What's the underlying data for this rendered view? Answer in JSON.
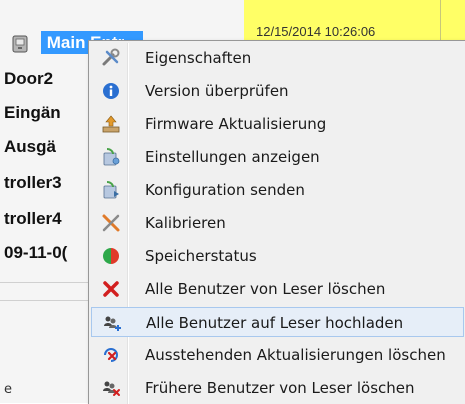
{
  "tree": {
    "rows": [
      {
        "label": "Main Entr..."
      },
      {
        "label": "Door2"
      },
      {
        "label": "Eingän"
      },
      {
        "label": "Ausgä"
      },
      {
        "label": "troller3"
      },
      {
        "label": "troller4"
      },
      {
        "label": "09-11-0("
      }
    ],
    "bottom_marker": "e"
  },
  "right": {
    "timestamp": "12/15/2014 10:26:06"
  },
  "menu": {
    "items": [
      {
        "label": "Eigenschaften",
        "icon": "tools-icon"
      },
      {
        "label": "Version überprüfen",
        "icon": "info-icon"
      },
      {
        "label": "Firmware Aktualisierung",
        "icon": "firmware-update-icon"
      },
      {
        "label": "Einstellungen anzeigen",
        "icon": "settings-view-icon"
      },
      {
        "label": "Konfiguration senden",
        "icon": "config-send-icon"
      },
      {
        "label": "Kalibrieren",
        "icon": "calibrate-icon"
      },
      {
        "label": "Speicherstatus",
        "icon": "memory-status-icon"
      },
      {
        "label": "Alle Benutzer von Leser löschen",
        "icon": "delete-x-icon"
      },
      {
        "label": "Alle Benutzer auf Leser hochladen",
        "icon": "users-upload-icon"
      },
      {
        "label": "Ausstehenden Aktualisierungen löschen",
        "icon": "pending-delete-icon"
      },
      {
        "label": "Frühere Benutzer von Leser löschen",
        "icon": "users-delete-icon"
      }
    ],
    "hover_index": 8
  },
  "colors": {
    "selection": "#3399ff",
    "header_yellow": "#ffff66",
    "menu_bg": "#f0f0f0"
  }
}
